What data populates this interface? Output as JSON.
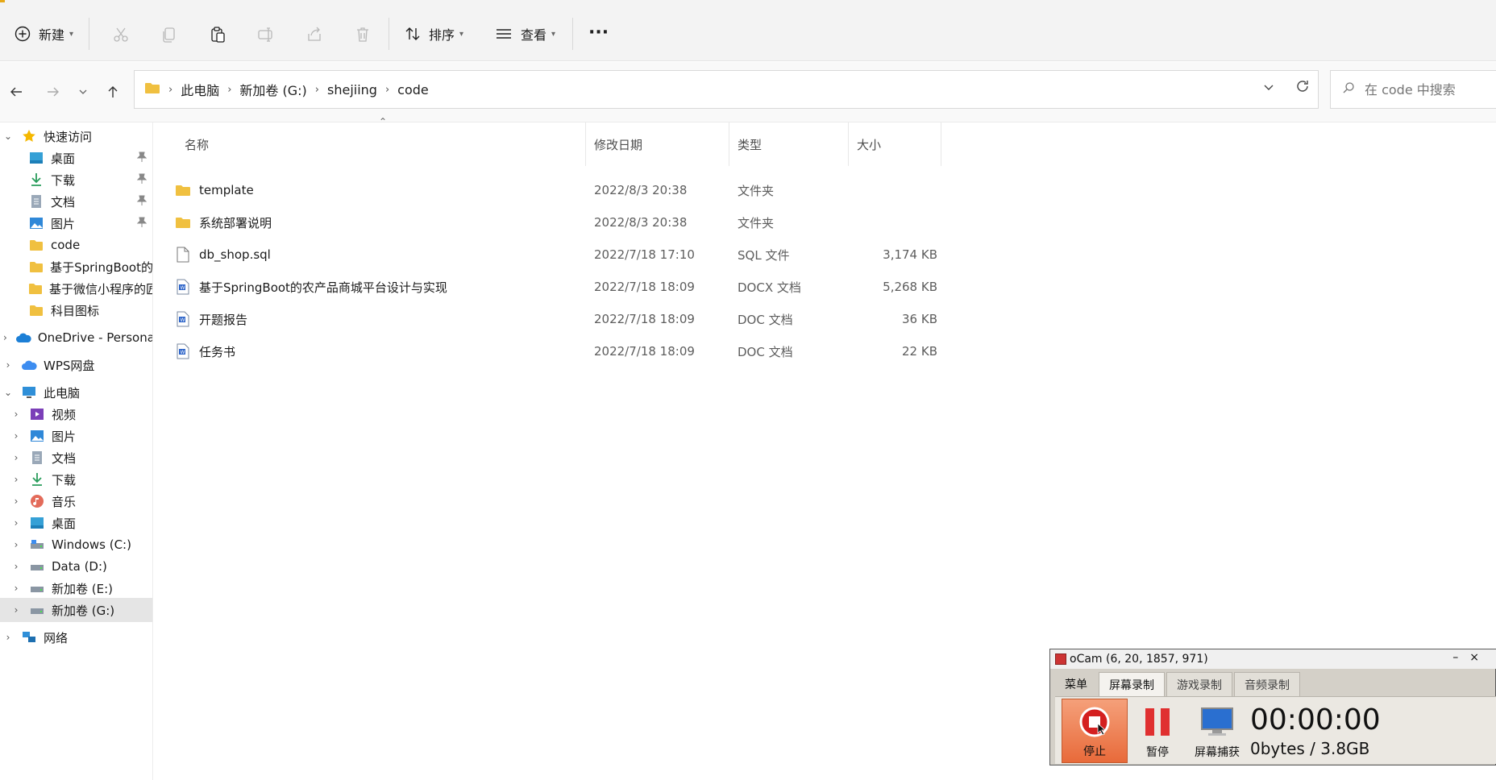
{
  "toolbar": {
    "new_label": "新建",
    "sort_label": "排序",
    "view_label": "查看",
    "more_label": "···"
  },
  "address": {
    "crumbs": [
      "此电脑",
      "新加卷 (G:)",
      "shejiing",
      "code"
    ],
    "search_placeholder": "在 code 中搜索"
  },
  "sidebar": {
    "quick_access": "快速访问",
    "quick_items": [
      {
        "label": "桌面",
        "icon": "desktop-icon",
        "pinned": true
      },
      {
        "label": "下载",
        "icon": "download-icon",
        "pinned": true
      },
      {
        "label": "文档",
        "icon": "document-icon",
        "pinned": true
      },
      {
        "label": "图片",
        "icon": "picture-icon",
        "pinned": true
      },
      {
        "label": "code",
        "icon": "folder-icon",
        "pinned": false
      },
      {
        "label": "基于SpringBoot的",
        "icon": "folder-icon",
        "pinned": false
      },
      {
        "label": "基于微信小程序的匠",
        "icon": "folder-icon",
        "pinned": false
      },
      {
        "label": "科目图标",
        "icon": "folder-icon",
        "pinned": false
      }
    ],
    "onedrive": "OneDrive - Persona",
    "wps": "WPS网盘",
    "this_pc": "此电脑",
    "pc_items": [
      {
        "label": "视频",
        "icon": "video-icon"
      },
      {
        "label": "图片",
        "icon": "picture-icon"
      },
      {
        "label": "文档",
        "icon": "document-icon"
      },
      {
        "label": "下载",
        "icon": "download-icon"
      },
      {
        "label": "音乐",
        "icon": "music-icon"
      },
      {
        "label": "桌面",
        "icon": "desktop-icon"
      },
      {
        "label": "Windows (C:)",
        "icon": "drive-icon"
      },
      {
        "label": "Data (D:)",
        "icon": "drive-icon"
      },
      {
        "label": "新加卷 (E:)",
        "icon": "drive-icon"
      },
      {
        "label": "新加卷 (G:)",
        "icon": "drive-icon"
      }
    ],
    "network": "网络"
  },
  "columns": {
    "name": "名称",
    "date": "修改日期",
    "type": "类型",
    "size": "大小"
  },
  "files": [
    {
      "name": "template",
      "date": "2022/8/3 20:38",
      "type": "文件夹",
      "size": "",
      "icon": "folder-icon"
    },
    {
      "name": "系统部署说明",
      "date": "2022/8/3 20:38",
      "type": "文件夹",
      "size": "",
      "icon": "folder-icon"
    },
    {
      "name": "db_shop.sql",
      "date": "2022/7/18 17:10",
      "type": "SQL 文件",
      "size": "3,174 KB",
      "icon": "file-icon"
    },
    {
      "name": "基于SpringBoot的农产品商城平台设计与实现",
      "date": "2022/7/18 18:09",
      "type": "DOCX 文档",
      "size": "5,268 KB",
      "icon": "word-doc-icon"
    },
    {
      "name": "开题报告",
      "date": "2022/7/18 18:09",
      "type": "DOC 文档",
      "size": "36 KB",
      "icon": "word-doc-icon"
    },
    {
      "name": "任务书",
      "date": "2022/7/18 18:09",
      "type": "DOC 文档",
      "size": "22 KB",
      "icon": "word-doc-icon"
    }
  ],
  "ocam": {
    "title": "oCam (6, 20, 1857, 971)",
    "tabs": [
      "菜单",
      "屏幕录制",
      "游戏录制",
      "音频录制"
    ],
    "stop_label": "停止",
    "pause_label": "暂停",
    "capture_label": "屏幕捕获",
    "timer": "00:00:00",
    "size": "0bytes / 3.8GB"
  },
  "colors": {
    "folder": "#f0c040",
    "accent": "#0067c0",
    "selected": "#e5e5e5"
  }
}
